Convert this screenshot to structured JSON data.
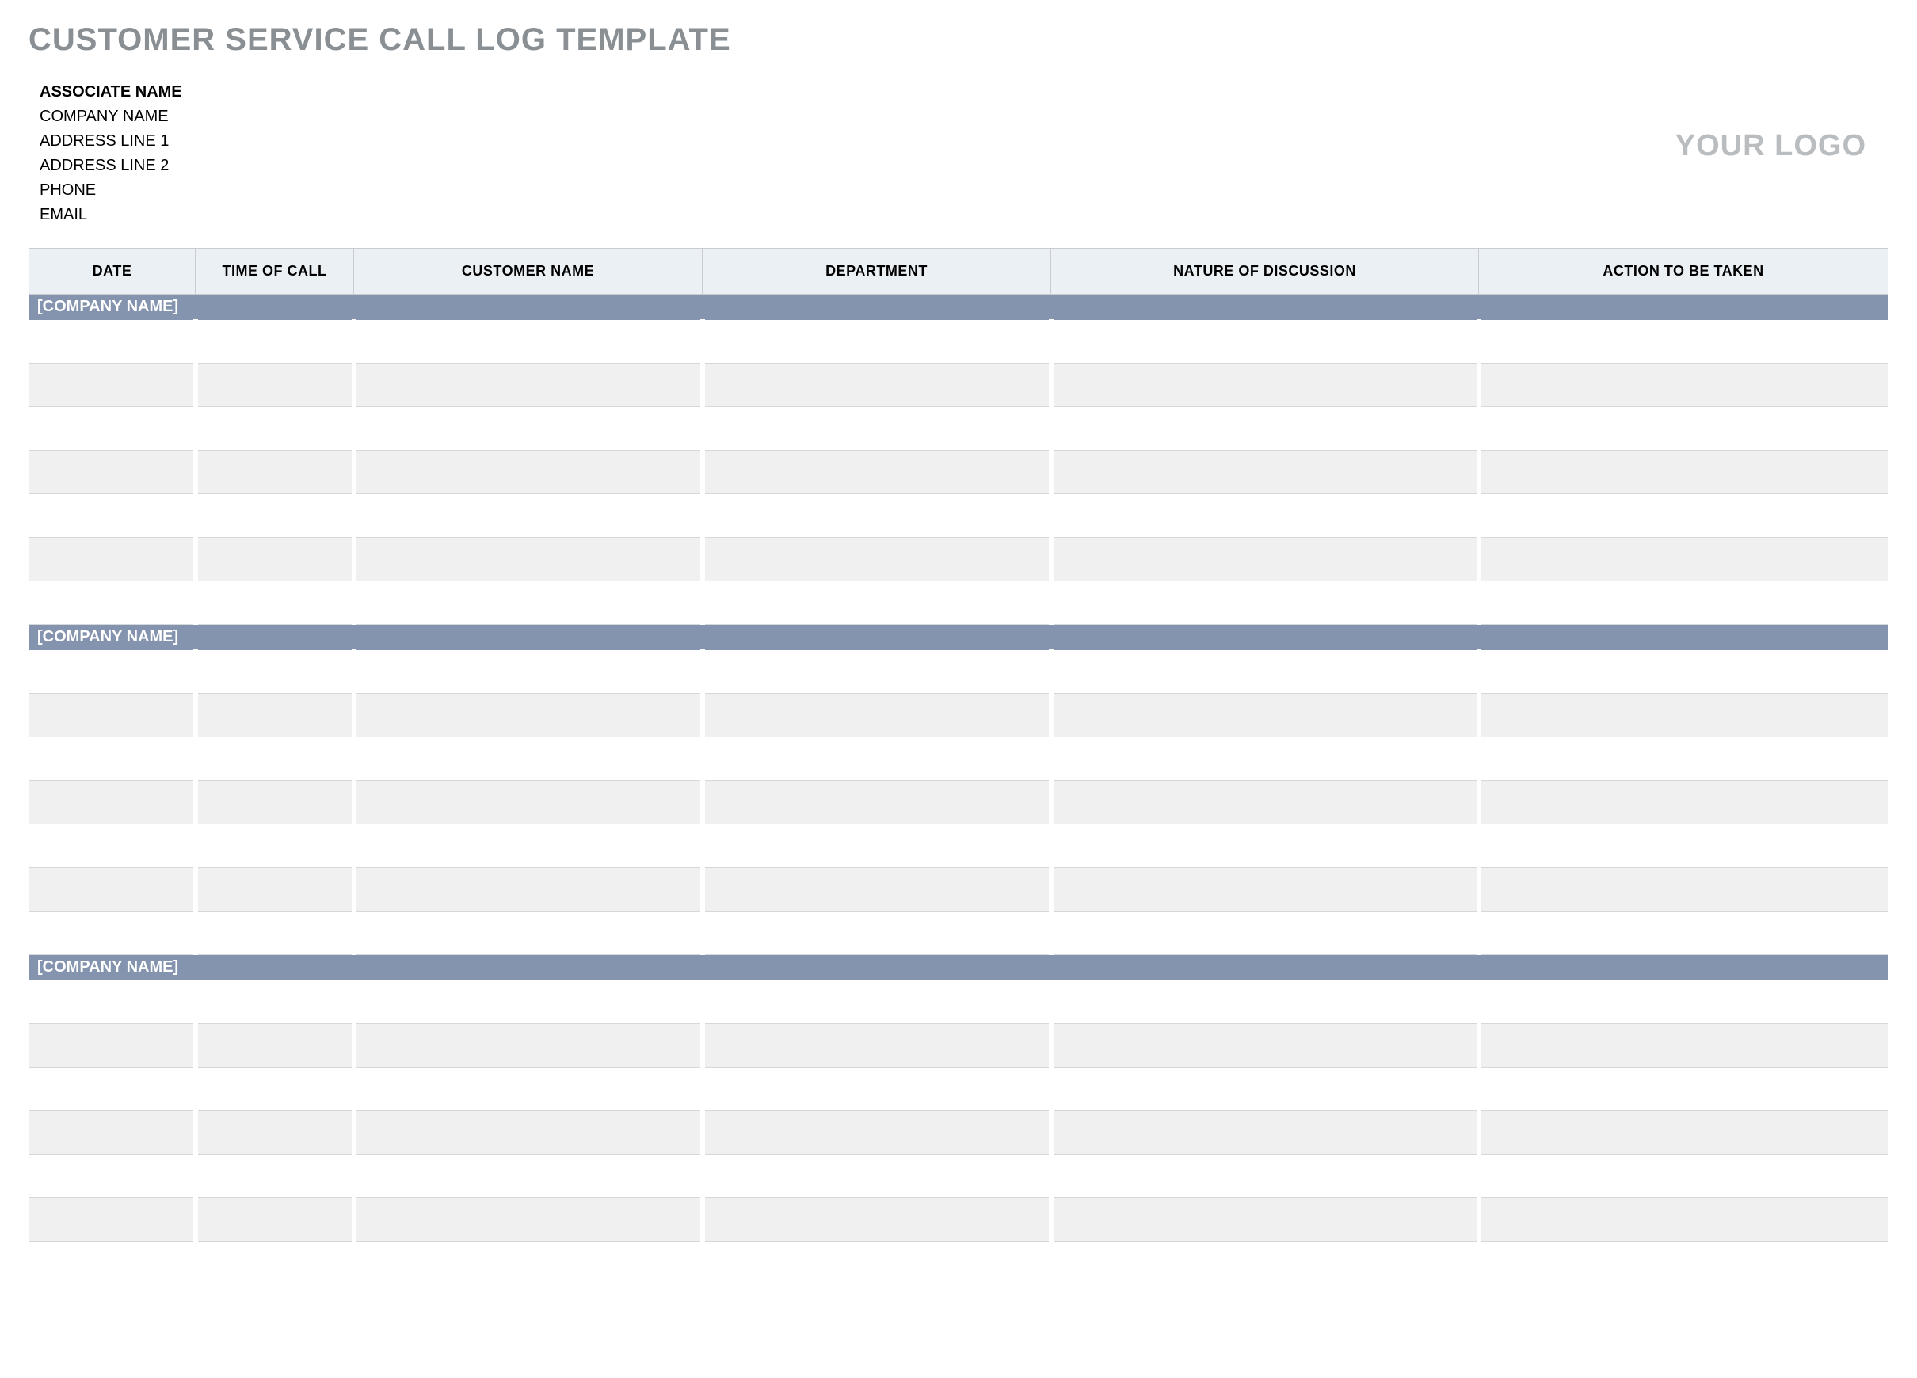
{
  "title": "CUSTOMER SERVICE CALL LOG TEMPLATE",
  "header": {
    "associate_label": "ASSOCIATE NAME",
    "lines": [
      "COMPANY NAME",
      "ADDRESS LINE 1",
      "ADDRESS LINE 2",
      "PHONE",
      "EMAIL"
    ],
    "logo_text": "YOUR LOGO"
  },
  "columns": [
    "DATE",
    "TIME OF CALL",
    "CUSTOMER NAME",
    "DEPARTMENT",
    "NATURE OF DISCUSSION",
    "ACTION TO BE TAKEN"
  ],
  "sections": [
    {
      "label": "[COMPANY NAME]",
      "rows": [
        {
          "date": "",
          "time": "",
          "customer": "",
          "dept": "",
          "nature": "",
          "action": ""
        },
        {
          "date": "",
          "time": "",
          "customer": "",
          "dept": "",
          "nature": "",
          "action": ""
        },
        {
          "date": "",
          "time": "",
          "customer": "",
          "dept": "",
          "nature": "",
          "action": ""
        },
        {
          "date": "",
          "time": "",
          "customer": "",
          "dept": "",
          "nature": "",
          "action": ""
        },
        {
          "date": "",
          "time": "",
          "customer": "",
          "dept": "",
          "nature": "",
          "action": ""
        },
        {
          "date": "",
          "time": "",
          "customer": "",
          "dept": "",
          "nature": "",
          "action": ""
        },
        {
          "date": "",
          "time": "",
          "customer": "",
          "dept": "",
          "nature": "",
          "action": ""
        }
      ]
    },
    {
      "label": "[COMPANY NAME]",
      "rows": [
        {
          "date": "",
          "time": "",
          "customer": "",
          "dept": "",
          "nature": "",
          "action": ""
        },
        {
          "date": "",
          "time": "",
          "customer": "",
          "dept": "",
          "nature": "",
          "action": ""
        },
        {
          "date": "",
          "time": "",
          "customer": "",
          "dept": "",
          "nature": "",
          "action": ""
        },
        {
          "date": "",
          "time": "",
          "customer": "",
          "dept": "",
          "nature": "",
          "action": ""
        },
        {
          "date": "",
          "time": "",
          "customer": "",
          "dept": "",
          "nature": "",
          "action": ""
        },
        {
          "date": "",
          "time": "",
          "customer": "",
          "dept": "",
          "nature": "",
          "action": ""
        },
        {
          "date": "",
          "time": "",
          "customer": "",
          "dept": "",
          "nature": "",
          "action": ""
        }
      ]
    },
    {
      "label": "[COMPANY NAME]",
      "rows": [
        {
          "date": "",
          "time": "",
          "customer": "",
          "dept": "",
          "nature": "",
          "action": ""
        },
        {
          "date": "",
          "time": "",
          "customer": "",
          "dept": "",
          "nature": "",
          "action": ""
        },
        {
          "date": "",
          "time": "",
          "customer": "",
          "dept": "",
          "nature": "",
          "action": ""
        },
        {
          "date": "",
          "time": "",
          "customer": "",
          "dept": "",
          "nature": "",
          "action": ""
        },
        {
          "date": "",
          "time": "",
          "customer": "",
          "dept": "",
          "nature": "",
          "action": ""
        },
        {
          "date": "",
          "time": "",
          "customer": "",
          "dept": "",
          "nature": "",
          "action": ""
        },
        {
          "date": "",
          "time": "",
          "customer": "",
          "dept": "",
          "nature": "",
          "action": ""
        }
      ]
    }
  ]
}
